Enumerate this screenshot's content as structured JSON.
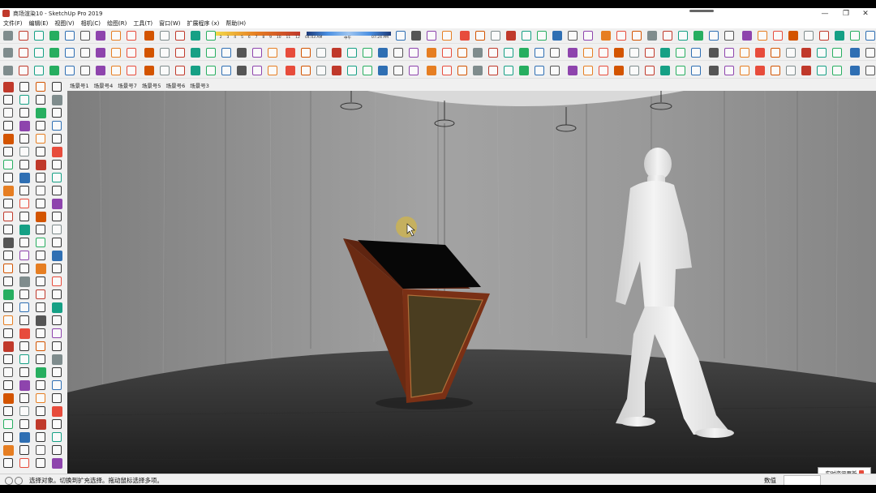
{
  "window": {
    "title": "商场渲染10 - SketchUp Pro 2019",
    "minimize_glyph": "—",
    "maximize_glyph": "❐",
    "close_glyph": "✕"
  },
  "menu": [
    "文件(F)",
    "编辑(E)",
    "视图(V)",
    "相机(C)",
    "绘图(R)",
    "工具(T)",
    "窗口(W)",
    "扩展程序 (x)",
    "帮助(H)"
  ],
  "shadow_toolbar": {
    "month_ticks": [
      "1",
      "2",
      "3",
      "4",
      "5",
      "6",
      "7",
      "8",
      "9",
      "10",
      "11",
      "12"
    ],
    "sunrise_time": "04:43 AM",
    "noon_time": "中午",
    "sunset_time": "07:24 PM"
  },
  "scene_tabs": [
    "场景号1",
    "场景号4",
    "场景号7",
    "场景号5",
    "场景号6",
    "场景号3"
  ],
  "status": {
    "hint": "选择对象。切换到扩充选择。拖动鼠标选择多项。",
    "measurements_label": "数值",
    "measurements_value": ""
  },
  "news_button": {
    "label": "实时资讯更新"
  },
  "colors": {
    "wall": "#8f8f8f",
    "floor": "#3a3a3a",
    "podium_wood": "#7a3015",
    "podium_panel": "#4a3d20",
    "screen": "#050505",
    "figure": "#e8e8e8",
    "accent_red": "#c0392b",
    "accent_blue": "#2f6fb3"
  }
}
